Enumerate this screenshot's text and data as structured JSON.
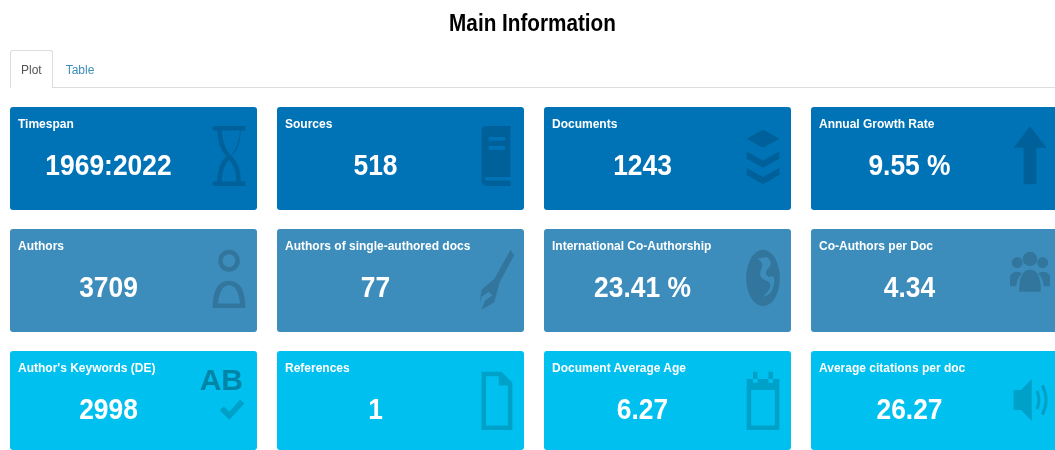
{
  "title": "Main Information",
  "tabs": [
    {
      "label": "Plot",
      "selected": true
    },
    {
      "label": "Table",
      "selected": false
    }
  ],
  "cards": [
    {
      "label": "Timespan",
      "value": "1969:2022",
      "color": "#0073b7"
    },
    {
      "label": "Sources",
      "value": "518",
      "color": "#0073b7"
    },
    {
      "label": "Documents",
      "value": "1243",
      "color": "#0073b7"
    },
    {
      "label": "Annual Growth Rate",
      "value": "9.55 %",
      "color": "#0073b7"
    },
    {
      "label": "Authors",
      "value": "3709",
      "color": "#3c8dbc"
    },
    {
      "label": "Authors of single-authored docs",
      "value": "77",
      "color": "#3c8dbc"
    },
    {
      "label": "International Co-Authorship",
      "value": "23.41 %",
      "color": "#3c8dbc"
    },
    {
      "label": "Co-Authors per Doc",
      "value": "4.34",
      "color": "#3c8dbc"
    },
    {
      "label": "Author's Keywords (DE)",
      "value": "2998",
      "color": "#00c0ef",
      "icon_text": "AB"
    },
    {
      "label": "References",
      "value": "1",
      "color": "#00c0ef"
    },
    {
      "label": "Document Average Age",
      "value": "6.27",
      "color": "#00c0ef"
    },
    {
      "label": "Average citations per doc",
      "value": "26.27",
      "color": "#00c0ef"
    }
  ]
}
